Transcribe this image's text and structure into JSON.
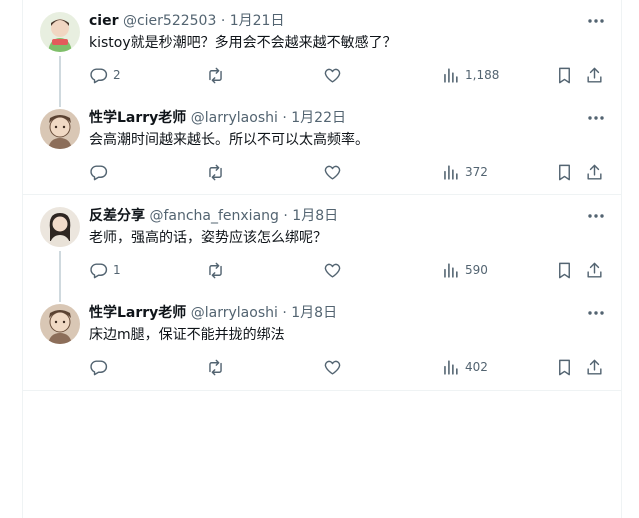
{
  "tweets": [
    {
      "name": "cier",
      "handle": "@cier522503",
      "dot": "·",
      "date": "1月21日",
      "text": "kistoy就是秒潮吧？多用会不会越来越不敏感了？",
      "replies": "2",
      "retweets": "",
      "likes": "",
      "views": "1,188",
      "avatar_color": "#7fbf6a"
    },
    {
      "name": "性学Larry老师",
      "handle": "@larrylaoshi",
      "dot": "·",
      "date": "1月22日",
      "text": "会高潮时间越来越长。所以不可以太高频率。",
      "replies": "",
      "retweets": "",
      "likes": "",
      "views": "372",
      "avatar_color": "#8c6e5a"
    },
    {
      "name": "反差分享",
      "handle": "@fancha_fenxiang",
      "dot": "·",
      "date": "1月8日",
      "text": "老师，强高的话，姿势应该怎么绑呢？",
      "replies": "1",
      "retweets": "",
      "likes": "",
      "views": "590",
      "avatar_color": "#c9b49a"
    },
    {
      "name": "性学Larry老师",
      "handle": "@larrylaoshi",
      "dot": "·",
      "date": "1月8日",
      "text": "床边m腿，保证不能并拢的绑法",
      "replies": "",
      "retweets": "",
      "likes": "",
      "views": "402",
      "avatar_color": "#8c6e5a"
    }
  ],
  "icons": {
    "more": "more-icon",
    "reply": "reply-icon",
    "retweet": "retweet-icon",
    "like": "heart-icon",
    "views": "views-icon",
    "bookmark": "bookmark-icon",
    "share": "share-icon"
  },
  "colors": {
    "text": "#0f1419",
    "secondary": "#536471",
    "thread_line": "#cfd9de",
    "divider": "#eff3f4"
  }
}
